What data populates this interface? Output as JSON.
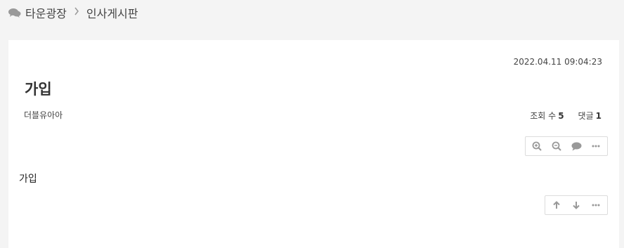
{
  "breadcrumb": {
    "section": "타운광장",
    "board": "인사게시판"
  },
  "post": {
    "date": "2022.04.11  09:04:23",
    "title": "가입",
    "author": "더블유아아",
    "views_label": "조회 수",
    "views": "5",
    "comments_label": "댓글",
    "comments": "1",
    "body": "가입"
  },
  "icons": {
    "breadcrumb": "comments-icon",
    "top_toolbar": [
      "zoom-in-icon",
      "zoom-out-icon",
      "comment-icon",
      "more-icon"
    ],
    "bottom_toolbar": [
      "arrow-up-icon",
      "arrow-down-icon",
      "more-icon"
    ]
  },
  "colors": {
    "icon": "#999999",
    "background": "#f4f4f4",
    "card": "#ffffff"
  }
}
